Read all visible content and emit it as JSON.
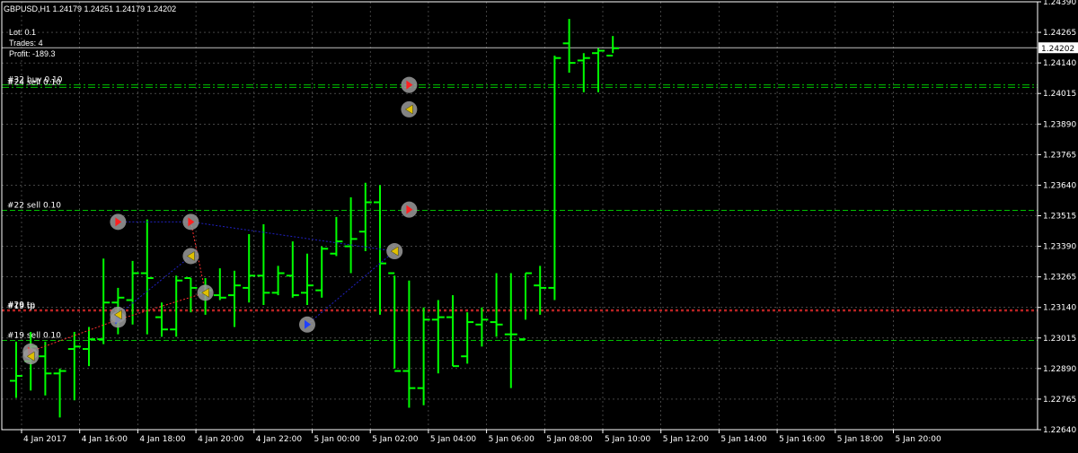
{
  "header": {
    "symbol_line": "GBPUSD,H1  1.24179 1.24251 1.24179 1.24202",
    "lot": "Lot: 0.1",
    "trades": "Trades: 4",
    "profit": "Profit: -189.3"
  },
  "colors": {
    "background": "#000000",
    "grid": "#c8c8c8",
    "candle": "#00ff00",
    "bid_line": "#c0c0c0",
    "order_line": "#00c000",
    "sl_line": "#ff3030",
    "price_label_bg": "#ffffff"
  },
  "chart_data": {
    "type": "ohlc",
    "symbol": "GBPUSD",
    "timeframe": "H1",
    "ylim": [
      1.2264,
      1.2439
    ],
    "y_ticks": [
      "1.24390",
      "1.24265",
      "1.24140",
      "1.24015",
      "1.23890",
      "1.23765",
      "1.23640",
      "1.23515",
      "1.23390",
      "1.23265",
      "1.23140",
      "1.23015",
      "1.22890",
      "1.22765",
      "1.22640"
    ],
    "x_ticks": [
      "4 Jan 2017",
      "4 Jan 16:00",
      "4 Jan 18:00",
      "4 Jan 20:00",
      "4 Jan 22:00",
      "5 Jan 00:00",
      "5 Jan 02:00",
      "5 Jan 04:00",
      "5 Jan 06:00",
      "5 Jan 08:00",
      "5 Jan 10:00",
      "5 Jan 12:00",
      "5 Jan 14:00",
      "5 Jan 16:00",
      "5 Jan 18:00",
      "5 Jan 20:00"
    ],
    "current_price": "1.24202",
    "bars": [
      {
        "o": 1.2284,
        "h": 1.23,
        "l": 1.2277,
        "c": 1.2286
      },
      {
        "o": 1.2292,
        "h": 1.2304,
        "l": 1.228,
        "c": 1.2298
      },
      {
        "o": 1.2294,
        "h": 1.23,
        "l": 1.2278,
        "c": 1.2287
      },
      {
        "o": 1.2287,
        "h": 1.2289,
        "l": 1.2269,
        "c": 1.2288
      },
      {
        "o": 1.2297,
        "h": 1.2304,
        "l": 1.2276,
        "c": 1.2298
      },
      {
        "o": 1.2297,
        "h": 1.2306,
        "l": 1.229,
        "c": 1.2301
      },
      {
        "o": 1.2301,
        "h": 1.2334,
        "l": 1.2299,
        "c": 1.2316
      },
      {
        "o": 1.2316,
        "h": 1.2322,
        "l": 1.2303,
        "c": 1.2318
      },
      {
        "o": 1.2317,
        "h": 1.2333,
        "l": 1.2307,
        "c": 1.2328
      },
      {
        "o": 1.2328,
        "h": 1.235,
        "l": 1.2303,
        "c": 1.2326
      },
      {
        "o": 1.231,
        "h": 1.2316,
        "l": 1.2302,
        "c": 1.2305
      },
      {
        "o": 1.2305,
        "h": 1.2327,
        "l": 1.2302,
        "c": 1.2325
      },
      {
        "o": 1.2326,
        "h": 1.2326,
        "l": 1.2312,
        "c": 1.2322
      },
      {
        "o": 1.232,
        "h": 1.2326,
        "l": 1.2311,
        "c": 1.2321
      },
      {
        "o": 1.2319,
        "h": 1.233,
        "l": 1.2317,
        "c": 1.2318
      },
      {
        "o": 1.2319,
        "h": 1.2329,
        "l": 1.2306,
        "c": 1.2323
      },
      {
        "o": 1.2322,
        "h": 1.2344,
        "l": 1.2316,
        "c": 1.2327
      },
      {
        "o": 1.2327,
        "h": 1.2348,
        "l": 1.2315,
        "c": 1.232
      },
      {
        "o": 1.232,
        "h": 1.2331,
        "l": 1.2319,
        "c": 1.2328
      },
      {
        "o": 1.2327,
        "h": 1.2341,
        "l": 1.2318,
        "c": 1.2319
      },
      {
        "o": 1.232,
        "h": 1.2336,
        "l": 1.2315,
        "c": 1.2323
      },
      {
        "o": 1.2321,
        "h": 1.2339,
        "l": 1.2318,
        "c": 1.2338
      },
      {
        "o": 1.2336,
        "h": 1.2351,
        "l": 1.2335,
        "c": 1.2341
      },
      {
        "o": 1.2339,
        "h": 1.2359,
        "l": 1.2328,
        "c": 1.2342
      },
      {
        "o": 1.2345,
        "h": 1.2365,
        "l": 1.2337,
        "c": 1.2357
      },
      {
        "o": 1.2357,
        "h": 1.2364,
        "l": 1.2311,
        "c": 1.2332
      },
      {
        "o": 1.2328,
        "h": 1.2327,
        "l": 1.2289,
        "c": 1.2288
      },
      {
        "o": 1.2288,
        "h": 1.2325,
        "l": 1.2273,
        "c": 1.2281
      },
      {
        "o": 1.2281,
        "h": 1.2314,
        "l": 1.2274,
        "c": 1.2309
      },
      {
        "o": 1.2309,
        "h": 1.2317,
        "l": 1.2287,
        "c": 1.231
      },
      {
        "o": 1.231,
        "h": 1.2319,
        "l": 1.229,
        "c": 1.229
      },
      {
        "o": 1.2294,
        "h": 1.2312,
        "l": 1.2291,
        "c": 1.2308
      },
      {
        "o": 1.2307,
        "h": 1.2314,
        "l": 1.2298,
        "c": 1.2309
      },
      {
        "o": 1.2308,
        "h": 1.2328,
        "l": 1.2302,
        "c": 1.2307
      },
      {
        "o": 1.2303,
        "h": 1.2328,
        "l": 1.2281,
        "c": 1.2303
      },
      {
        "o": 1.2301,
        "h": 1.2328,
        "l": 1.2309,
        "c": 1.2328
      },
      {
        "o": 1.2323,
        "h": 1.2331,
        "l": 1.2311,
        "c": 1.2322
      },
      {
        "o": 1.2322,
        "h": 1.2417,
        "l": 1.2317,
        "c": 1.2416
      },
      {
        "o": 1.2422,
        "h": 1.2432,
        "l": 1.241,
        "c": 1.2414
      },
      {
        "o": 1.2415,
        "h": 1.2418,
        "l": 1.2402,
        "c": 1.2416
      },
      {
        "o": 1.2418,
        "h": 1.242,
        "l": 1.2402,
        "c": 1.2419
      },
      {
        "o": 1.2417,
        "h": 1.2425,
        "l": 1.2418,
        "c": 1.242
      }
    ],
    "order_lines": [
      {
        "label": "#32 buy 0.10",
        "price": 1.2405,
        "style": "dashdot"
      },
      {
        "label": "#24 sell 0.10",
        "price": 1.2404,
        "style": "dashdot"
      },
      {
        "label": "#22 sell 0.10",
        "price": 1.23537,
        "style": "dash"
      },
      {
        "label": "#19 sell 0.10",
        "price": 1.23005,
        "style": "dash"
      }
    ],
    "stop_lines": [
      {
        "label": "#29 tp",
        "price": 1.2313
      },
      {
        "label": "#19 tp",
        "price": 1.23125
      }
    ],
    "trade_markers": [
      {
        "bar": 1,
        "price": 1.2296,
        "kind": "sell"
      },
      {
        "bar": 1,
        "price": 1.2294,
        "kind": "close"
      },
      {
        "bar": 7,
        "price": 1.2349,
        "kind": "sell"
      },
      {
        "bar": 7,
        "price": 1.2309,
        "kind": "buy"
      },
      {
        "bar": 7,
        "price": 1.2311,
        "kind": "close"
      },
      {
        "bar": 12,
        "price": 1.2349,
        "kind": "sell"
      },
      {
        "bar": 12,
        "price": 1.2335,
        "kind": "close"
      },
      {
        "bar": 13,
        "price": 1.232,
        "kind": "close"
      },
      {
        "bar": 20,
        "price": 1.2307,
        "kind": "buy"
      },
      {
        "bar": 26,
        "price": 1.2337,
        "kind": "close"
      },
      {
        "bar": 27,
        "price": 1.2354,
        "kind": "sell"
      },
      {
        "bar": 27,
        "price": 1.2395,
        "kind": "close"
      },
      {
        "bar": 27,
        "price": 1.2405,
        "kind": "sell"
      }
    ]
  }
}
